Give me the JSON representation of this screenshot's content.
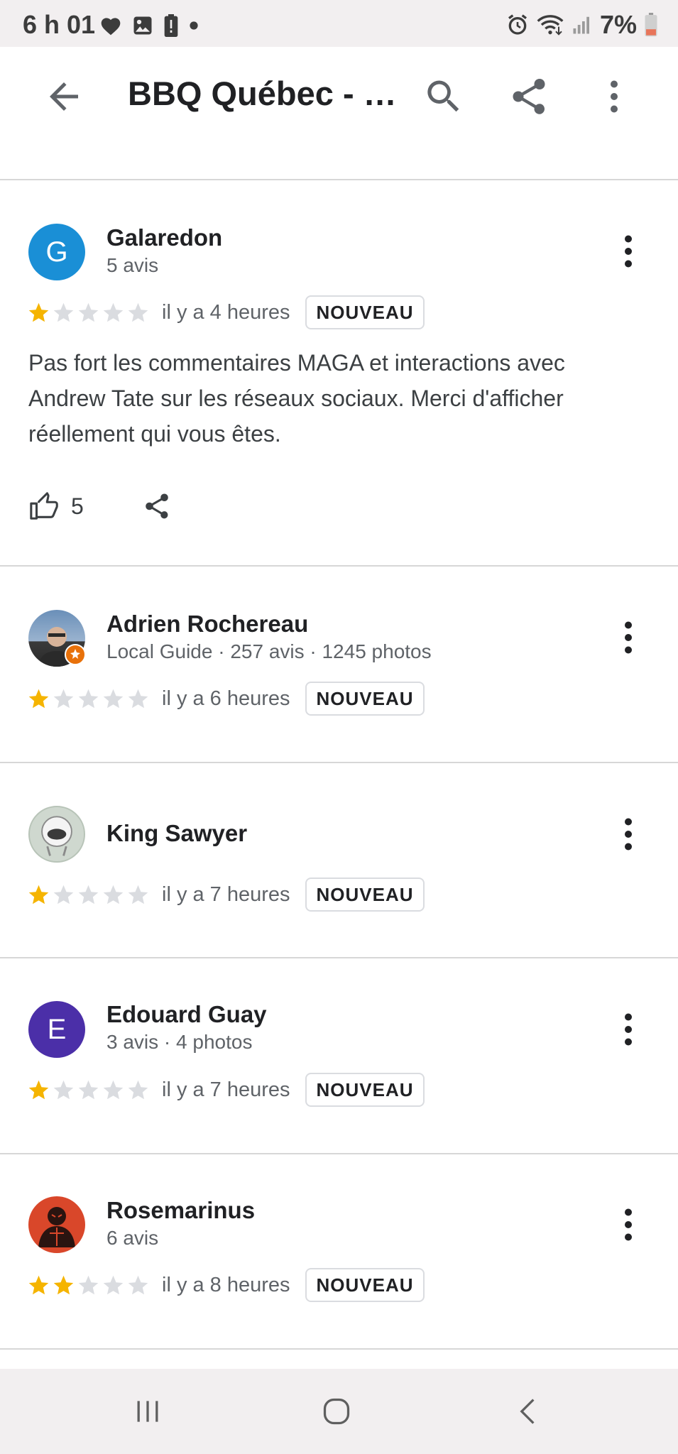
{
  "status_bar": {
    "time": "6 h 01",
    "battery": "7%",
    "icons_left": [
      "heart-icon",
      "image-icon",
      "battery-alert-icon",
      "dot-icon"
    ],
    "icons_right": [
      "alarm-icon",
      "wifi-icon",
      "signal-icon",
      "battery-icon"
    ]
  },
  "app_bar": {
    "title": "BBQ Québec - …",
    "back_icon": "arrow-back-icon",
    "search_icon": "search-icon",
    "share_icon": "share-icon",
    "more_icon": "more-vert-icon"
  },
  "reviews": [
    {
      "name": "Galaredon",
      "avatar_letter": "G",
      "avatar_color": "#1a8fd6",
      "meta": "5 avis",
      "rating": 1,
      "time": "il y a 4 heures",
      "badge": "NOUVEAU",
      "text": "Pas fort les commentaires MAGA et interactions avec Andrew Tate sur les réseaux sociaux. Merci d'afficher réellement qui vous êtes.",
      "likes": "5"
    },
    {
      "name": "Adrien Rochereau",
      "avatar_letter": "",
      "avatar_color": "#6a8fb8",
      "meta": "Local Guide · 257 avis · 1245 photos",
      "rating": 1,
      "time": "il y a 6 heures",
      "badge": "NOUVEAU"
    },
    {
      "name": "King Sawyer",
      "avatar_letter": "",
      "avatar_color": "#cfd8cf",
      "meta": "",
      "rating": 1,
      "time": "il y a 7 heures",
      "badge": "NOUVEAU"
    },
    {
      "name": "Edouard Guay",
      "avatar_letter": "E",
      "avatar_color": "#4b2fa8",
      "meta": "3 avis · 4 photos",
      "rating": 1,
      "time": "il y a 7 heures",
      "badge": "NOUVEAU"
    },
    {
      "name": "Rosemarinus",
      "avatar_letter": "",
      "avatar_color": "#d9472a",
      "meta": "6 avis",
      "rating": 2,
      "time": "il y a 8 heures",
      "badge": "NOUVEAU"
    }
  ],
  "colors": {
    "star_filled": "#f5b400",
    "star_empty": "#dadce0"
  },
  "nav_bar": {
    "recents_icon": "recents-icon",
    "home_icon": "home-icon",
    "back_icon": "nav-back-icon"
  }
}
